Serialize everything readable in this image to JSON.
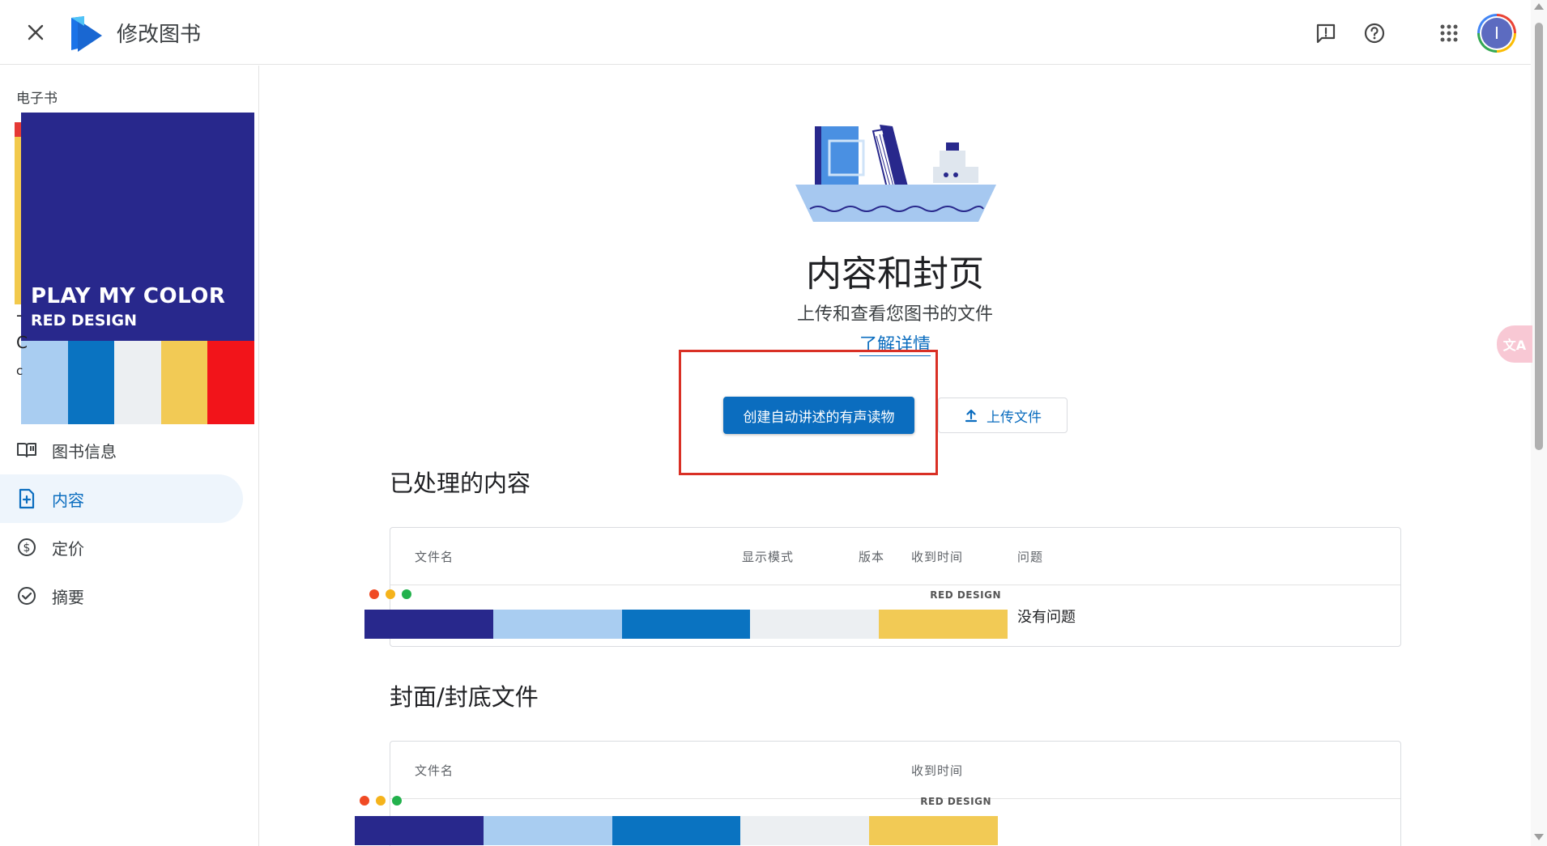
{
  "header": {
    "title": "修改图书",
    "avatar_initial": "I"
  },
  "sidebar": {
    "section_label": "电子书",
    "cover": {
      "title": "PLAY MY COLOR",
      "subtitle": "RED DESIGN",
      "stripe_colors": [
        "#a9cdf1",
        "#0a73c1",
        "#eceff2",
        "#f2ca55",
        "#f2141a"
      ],
      "partial_glyphs": [
        "-",
        "C",
        "c"
      ]
    },
    "nav": [
      {
        "label": "图书信息",
        "icon": "book-open-icon",
        "active": false
      },
      {
        "label": "内容",
        "icon": "file-add-icon",
        "active": true
      },
      {
        "label": "定价",
        "icon": "dollar-circle-icon",
        "active": false
      },
      {
        "label": "摘要",
        "icon": "check-circle-icon",
        "active": false
      }
    ]
  },
  "main": {
    "title": "内容和封页",
    "subtitle": "上传和查看您图书的文件",
    "learn_more": "了解详情",
    "primary_button": "创建自动讲述的有声读物",
    "upload_button": "上传文件",
    "processed": {
      "heading": "已处理的内容",
      "columns": [
        "文件名",
        "显示模式",
        "版本",
        "收到时间",
        "问题"
      ],
      "rows": [
        {
          "thumb_label": "RED DESIGN",
          "issue": "没有问题"
        }
      ]
    },
    "cover_files": {
      "heading": "封面/封底文件",
      "columns": [
        "文件名",
        "收到时间"
      ],
      "rows": [
        {
          "thumb_label": "RED DESIGN"
        }
      ]
    },
    "thumb_stripe_colors": [
      "#28288c",
      "#a9cdf1",
      "#0a73c1",
      "#eceff2",
      "#f2ca55"
    ],
    "dot_colors": [
      "#f04a24",
      "#f5b31b",
      "#22b14c"
    ]
  },
  "colors": {
    "accent": "#0b6dbf",
    "highlight": "#d93025"
  },
  "translate_pill": "文A"
}
